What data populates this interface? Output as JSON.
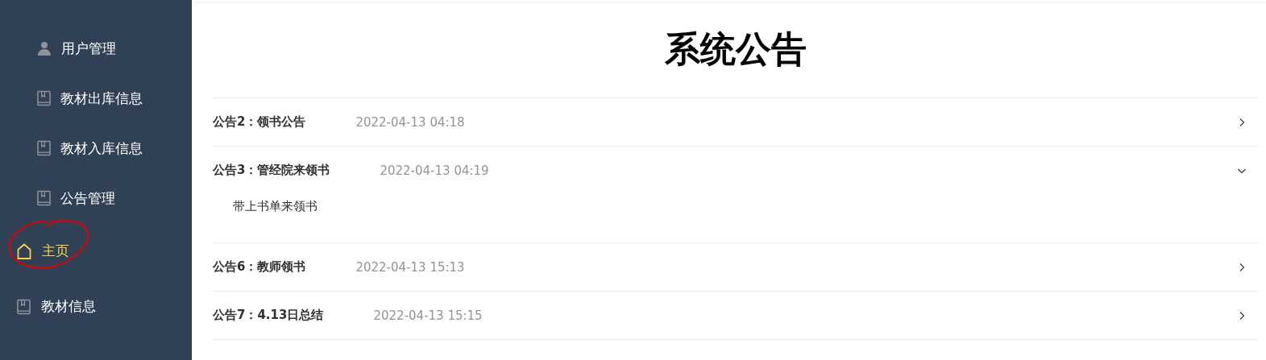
{
  "sidebar": {
    "submenu": [
      {
        "label": "用户管理",
        "kind": "user",
        "selected": false
      },
      {
        "label": "教材出库信息",
        "kind": "book",
        "selected": false
      },
      {
        "label": "教材入库信息",
        "kind": "book",
        "selected": false
      },
      {
        "label": "公告管理",
        "kind": "book",
        "selected": false
      }
    ],
    "items": [
      {
        "label": "主页",
        "kind": "home",
        "selected": true
      },
      {
        "label": "教材信息",
        "kind": "book",
        "selected": false
      }
    ]
  },
  "page_title": "系统公告",
  "notices": [
    {
      "title": "公告2：领书公告",
      "date": "2022-04-13 04:18",
      "expanded": false
    },
    {
      "title": "公告3：管经院来领书",
      "date": "2022-04-13 04:19",
      "expanded": true,
      "content": "带上书单来领书"
    },
    {
      "title": "公告6：教师领书",
      "date": "2022-04-13 15:13",
      "expanded": false
    },
    {
      "title": "公告7：4.13日总结",
      "date": "2022-04-13 15:15",
      "expanded": false
    }
  ]
}
